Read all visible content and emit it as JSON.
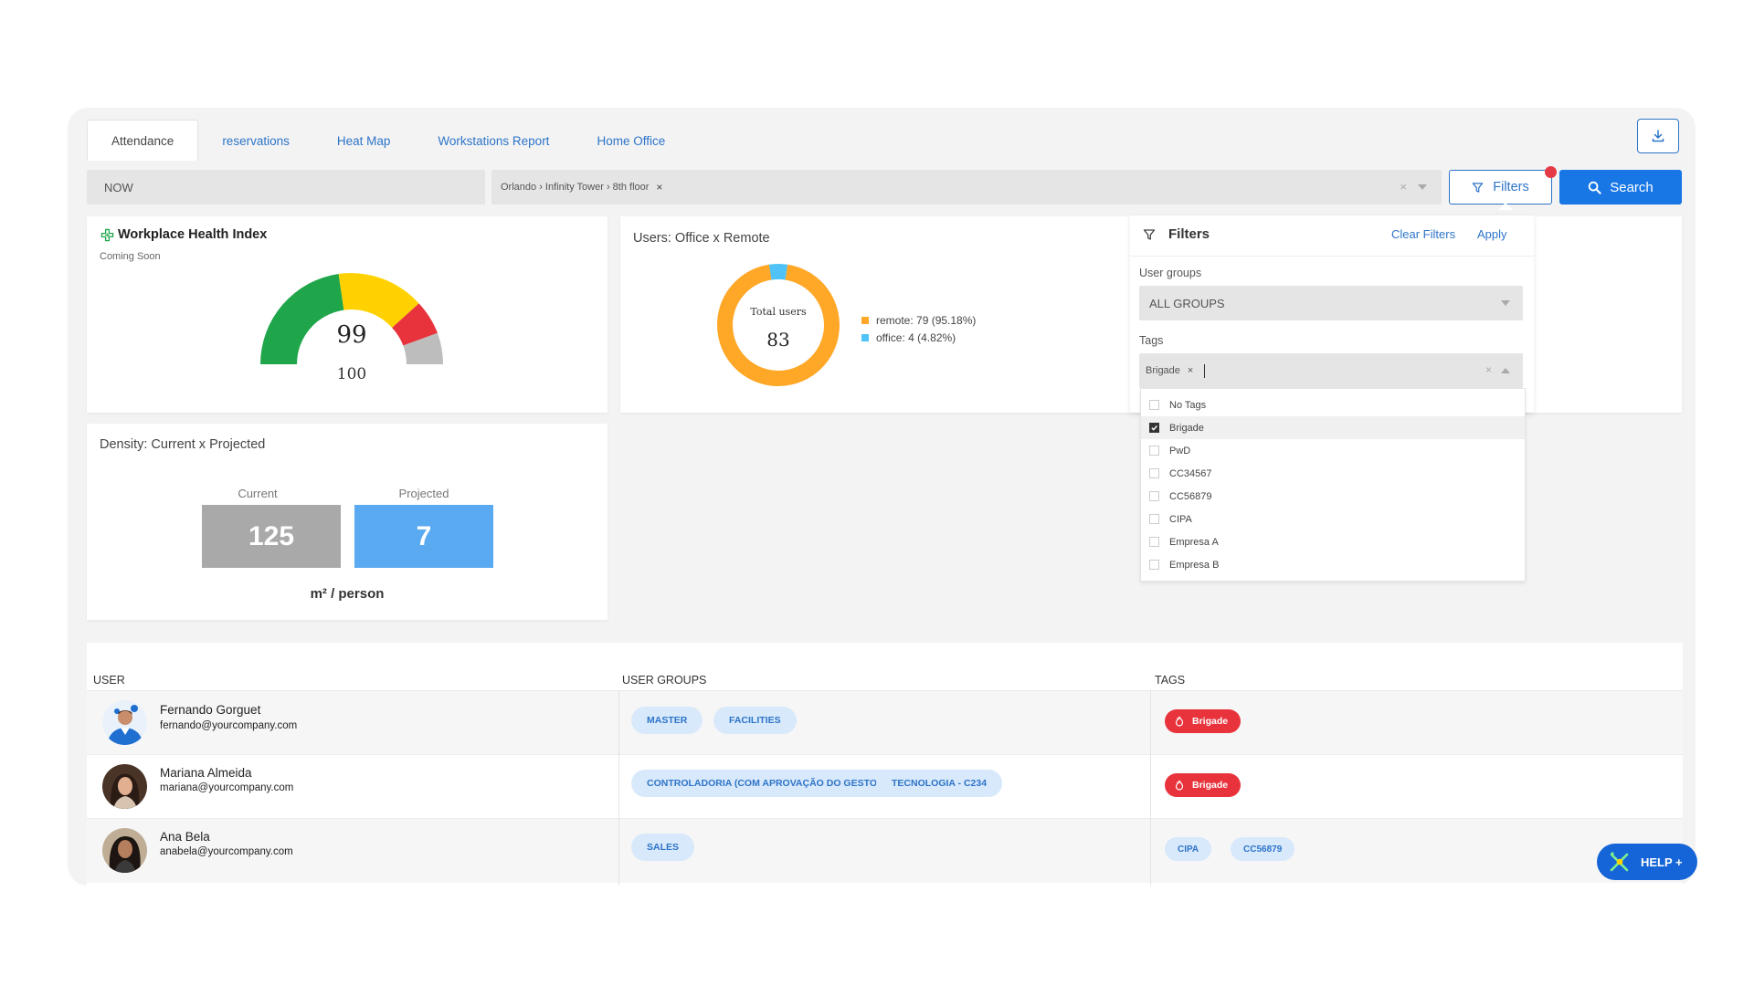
{
  "tabs": [
    {
      "label": "Attendance",
      "active": true
    },
    {
      "label": "reservations"
    },
    {
      "label": "Heat Map"
    },
    {
      "label": "Workstations Report"
    },
    {
      "label": "Home Office"
    }
  ],
  "filter_bar": {
    "time_value": "NOW",
    "location_chip": "Orlando › Infinity Tower › 8th floor",
    "filters_label": "Filters",
    "search_label": "Search"
  },
  "health": {
    "title": "Workplace Health Index",
    "subtitle": "Coming Soon",
    "value": "99",
    "max": "100",
    "colors": {
      "green": "#1fa64a",
      "yellow": "#ffd100",
      "red": "#e8333c",
      "grey": "#bdbdbd"
    }
  },
  "users": {
    "title": "Users: Office x Remote",
    "total_label": "Total users",
    "total": "83",
    "remote_legend": "remote: 79 (95.18%)",
    "office_legend": "office: 4 (4.82%)",
    "remote_share": 0.9518,
    "office_share": 0.0482,
    "colors": {
      "remote": "#ffa726",
      "office": "#4fc3f7"
    }
  },
  "density": {
    "title": "Density: Current x Projected",
    "current_label": "Current",
    "current_value": "125",
    "projected_label": "Projected",
    "projected_value": "7",
    "unit": "m² / person",
    "colors": {
      "current": "#a9a9a9",
      "projected": "#5aaaf2"
    }
  },
  "filters_panel": {
    "title": "Filters",
    "clear_label": "Clear Filters",
    "apply_label": "Apply",
    "user_groups_label": "User groups",
    "user_groups_value": "ALL GROUPS",
    "tags_label": "Tags",
    "selected_tag": "Brigade",
    "tag_options": [
      {
        "label": "No Tags",
        "checked": false
      },
      {
        "label": "Brigade",
        "checked": true
      },
      {
        "label": "PwD",
        "checked": false
      },
      {
        "label": "CC34567",
        "checked": false
      },
      {
        "label": "CC56879",
        "checked": false
      },
      {
        "label": "CIPA",
        "checked": false
      },
      {
        "label": "Empresa A",
        "checked": false
      },
      {
        "label": "Empresa B",
        "checked": false
      }
    ]
  },
  "table": {
    "headers": [
      "USER",
      "USER GROUPS",
      "TAGS"
    ],
    "rows": [
      {
        "name": "Fernando Gorguet",
        "email": "fernando@yourcompany.com",
        "groups": [
          "MASTER",
          "FACILITIES"
        ],
        "tags": [
          "Brigade"
        ]
      },
      {
        "name": "Mariana Almeida",
        "email": "mariana@yourcompany.com",
        "groups": [
          "CONTROLADORIA (COM APROVAÇÃO DO GESTOR)",
          "TECNOLOGIA - C234"
        ],
        "tags": [
          "Brigade"
        ]
      },
      {
        "name": "Ana Bela",
        "email": "anabela@yourcompany.com",
        "groups": [
          "SALES"
        ],
        "tags": [
          "CIPA",
          "CC56879"
        ]
      }
    ]
  },
  "help": {
    "label": "HELP +"
  }
}
